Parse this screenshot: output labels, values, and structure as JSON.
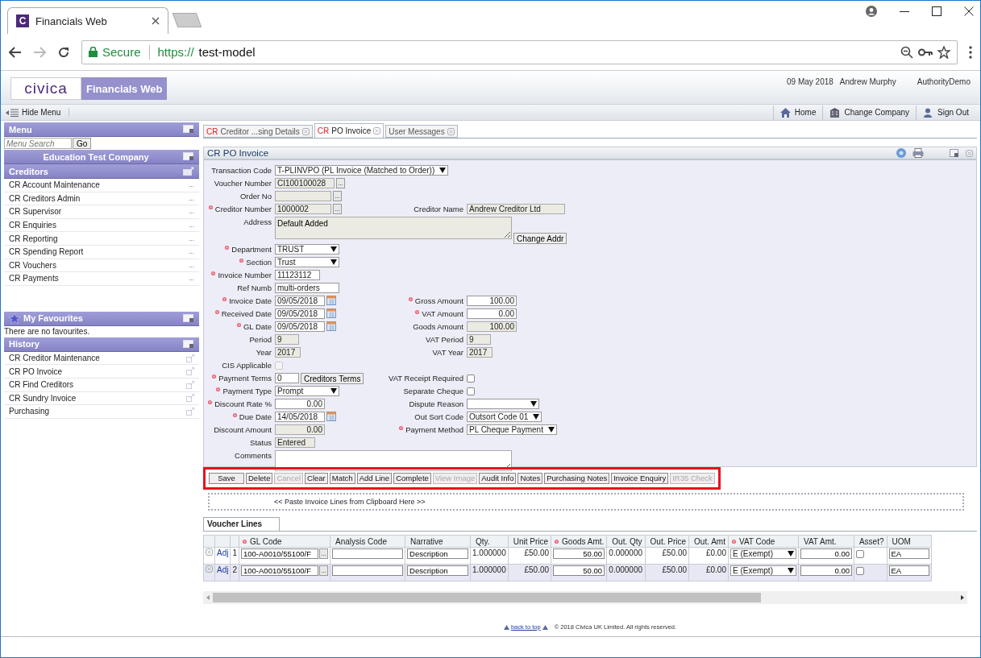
{
  "browser": {
    "favicon_letter": "C",
    "tab_title": "Financials Web",
    "secure_label": "Secure",
    "url_scheme": "https://",
    "url_host": "test-model"
  },
  "header": {
    "logo": "civica",
    "product": "Financials Web",
    "date": "09 May 2018",
    "user": "Andrew Murphy",
    "authority": "AuthorityDemo"
  },
  "toolbar": {
    "hide_menu": "Hide Menu",
    "links": [
      {
        "kind": "home",
        "label": "Home"
      },
      {
        "kind": "company",
        "label": "Change Company"
      },
      {
        "kind": "signout",
        "label": "Sign Out"
      }
    ]
  },
  "sidebar": {
    "menu_title": "Menu",
    "search_placeholder": "Menu Search",
    "go": "Go",
    "company": "Education Test Company",
    "section": "Creditors",
    "items": [
      {
        "label": "CR Account Maintenance",
        "more": "..."
      },
      {
        "label": "CR Creditors Admin",
        "more": "..."
      },
      {
        "label": "CR Supervisor",
        "more": "..."
      },
      {
        "label": "CR Enquiries",
        "more": "..."
      },
      {
        "label": "CR Reporting",
        "more": "..."
      },
      {
        "label": "CR Spending Report",
        "more": "..."
      },
      {
        "label": "CR Vouchers",
        "more": "..."
      },
      {
        "label": "CR Payments",
        "more": "..."
      }
    ],
    "favourites_title": "My Favourites",
    "favourites_empty": "There are no favourites.",
    "history_title": "History",
    "history_items": [
      {
        "label": "CR Creditor Maintenance"
      },
      {
        "label": "CR PO Invoice"
      },
      {
        "label": "CR Find Creditors"
      },
      {
        "label": "CR Sundry Invoice"
      },
      {
        "label": "Purchasing"
      }
    ]
  },
  "tabs": [
    {
      "prefix": "CR",
      "label": "Creditor ...sing Details",
      "selected": false
    },
    {
      "prefix": "CR",
      "label": "PO Invoice",
      "selected": true
    },
    {
      "label": "User Messages",
      "selected": false
    }
  ],
  "form": {
    "title": "CR PO Invoice",
    "rows": [
      {
        "left": {
          "label": "Transaction Code",
          "required": false,
          "kind": "select",
          "value": "T-PLINVPO (PL Invoice (Matched to Order))"
        }
      },
      {
        "left": {
          "label": "Voucher Number",
          "required": false,
          "kind": "text",
          "readonly": true,
          "value": "CI100100028",
          "lookup": "..."
        }
      },
      {
        "left": {
          "label": "Order No",
          "required": false,
          "kind": "text",
          "readonly": true,
          "lookup": "..."
        }
      },
      {
        "left": {
          "label": "Creditor Number",
          "required": true,
          "kind": "text",
          "readonly": true,
          "value": "1000002",
          "lookup": "..."
        },
        "right": {
          "label": "Creditor Name",
          "required": false,
          "kind": "text",
          "readonly": true,
          "value": "Andrew Creditor Ltd"
        }
      },
      {
        "left": {
          "label": "Address",
          "required": false,
          "kind": "textarea",
          "readonly": true,
          "value": "Default Added",
          "button": "Change Addr"
        }
      },
      {
        "left": {
          "label": "Department",
          "required": true,
          "kind": "select",
          "value": "TRUST"
        }
      },
      {
        "left": {
          "label": "Section",
          "required": true,
          "kind": "select",
          "value": "Trust"
        }
      },
      {
        "left": {
          "label": "Invoice Number",
          "required": true,
          "kind": "text",
          "readonly": false,
          "value": "11123112"
        }
      },
      {
        "left": {
          "label": "Ref Numb",
          "required": false,
          "kind": "text",
          "readonly": false,
          "value": "multi-orders"
        }
      },
      {
        "left": {
          "label": "Invoice Date",
          "required": true,
          "kind": "date",
          "value": "09/05/2018"
        },
        "right": {
          "label": "Gross Amount",
          "required": true,
          "kind": "amount",
          "readonly": false,
          "value": "100.00"
        }
      },
      {
        "left": {
          "label": "Received Date",
          "required": true,
          "kind": "date",
          "value": "09/05/2018"
        },
        "right": {
          "label": "VAT Amount",
          "required": true,
          "kind": "amount",
          "readonly": false,
          "value": "0.00"
        }
      },
      {
        "left": {
          "label": "GL Date",
          "required": true,
          "kind": "date",
          "value": "09/05/2018"
        },
        "right": {
          "label": "Goods Amount",
          "required": false,
          "kind": "amount",
          "readonly": true,
          "value": "100.00"
        }
      },
      {
        "left": {
          "label": "Period",
          "required": false,
          "kind": "text",
          "readonly": true,
          "value": "9"
        },
        "right": {
          "label": "VAT Period",
          "required": false,
          "kind": "text",
          "readonly": true,
          "value": "9"
        }
      },
      {
        "left": {
          "label": "Year",
          "required": false,
          "kind": "text",
          "readonly": true,
          "value": "2017"
        },
        "right": {
          "label": "VAT Year",
          "required": false,
          "kind": "text",
          "readonly": true,
          "value": "2017"
        }
      },
      {
        "left": {
          "label": "CIS Applicable",
          "required": false,
          "kind": "checkbox",
          "checked": false,
          "disabled": true
        }
      },
      {
        "left": {
          "label": "Payment Terms",
          "required": true,
          "kind": "text",
          "readonly": false,
          "value": "0",
          "button": "Creditors Terms"
        },
        "right": {
          "label": "VAT Receipt Required",
          "required": false,
          "kind": "checkbox",
          "checked": false,
          "disabled": false
        }
      },
      {
        "left": {
          "label": "Payment Type",
          "required": true,
          "kind": "select",
          "value": "Prompt"
        },
        "right": {
          "label": "Separate Cheque",
          "required": false,
          "kind": "checkbox",
          "checked": false,
          "disabled": false
        }
      },
      {
        "left": {
          "label": "Discount Rate %",
          "required": true,
          "kind": "amount",
          "readonly": false,
          "value": "0.00"
        },
        "right": {
          "label": "Dispute Reason",
          "required": false,
          "kind": "select"
        }
      },
      {
        "left": {
          "label": "Due Date",
          "required": true,
          "kind": "date",
          "value": "14/05/2018"
        },
        "right": {
          "label": "Out Sort Code",
          "required": false,
          "kind": "select",
          "value": "Outsort Code 01"
        }
      },
      {
        "left": {
          "label": "Discount Amount",
          "required": false,
          "kind": "amount",
          "readonly": true,
          "value": "0.00"
        },
        "right": {
          "label": "Payment Method",
          "required": true,
          "kind": "select",
          "value": "PL Cheque Payment"
        }
      },
      {
        "left": {
          "label": "Status",
          "required": false,
          "kind": "text",
          "readonly": true,
          "value": "Entered"
        }
      },
      {
        "left": {
          "label": "Comments",
          "required": false,
          "kind": "textarea",
          "readonly": false
        }
      }
    ],
    "buttons": [
      {
        "label": "Save",
        "disabled": false
      },
      {
        "label": "Delete",
        "disabled": false
      },
      {
        "label": "Cancel",
        "disabled": true
      },
      {
        "label": "Clear",
        "disabled": false
      },
      {
        "label": "Match",
        "disabled": false
      },
      {
        "label": "Add Line",
        "disabled": false
      },
      {
        "label": "Complete",
        "disabled": false
      },
      {
        "label": "View Image",
        "disabled": true
      },
      {
        "label": "Audit Info",
        "disabled": false
      },
      {
        "label": "Notes",
        "disabled": false
      },
      {
        "label": "Purchasing Notes",
        "disabled": false
      },
      {
        "label": "Invoice Enquiry",
        "disabled": false
      },
      {
        "label": "IR35 Check",
        "disabled": true
      }
    ],
    "paste_area": "<< Paste Invoice Lines from Clipboard Here >>"
  },
  "voucher_lines": {
    "tab": "Voucher Lines",
    "columns": [
      {
        "label": "GL Code",
        "required": true
      },
      {
        "label": "Analysis Code",
        "required": false
      },
      {
        "label": "Narrative",
        "required": false
      },
      {
        "label": "Qty.",
        "required": false
      },
      {
        "label": "Unit Price",
        "required": false
      },
      {
        "label": "Goods Amt.",
        "required": true
      },
      {
        "label": "Out. Qty",
        "required": false
      },
      {
        "label": "Out. Price",
        "required": false
      },
      {
        "label": "Out. Amt",
        "required": false
      },
      {
        "label": "VAT Code",
        "required": true
      },
      {
        "label": "VAT Amt.",
        "required": false
      },
      {
        "label": "Asset?",
        "required": false
      },
      {
        "label": "UOM",
        "required": false
      }
    ],
    "rows": [
      {
        "action": "Adj",
        "number": "1",
        "gl_code": "100-A0010/55100/F",
        "lookup": "...",
        "narrative": "Description",
        "qty": "1.000000",
        "unit_price": "£50.00",
        "goods_amt": "50.00",
        "out_qty": "0.000000",
        "out_price": "£50.00",
        "out_amt": "£0.00",
        "vat_code": "E (Exempt)",
        "vat_amt": "0.00",
        "asset": false,
        "uom": "EA"
      },
      {
        "action": "Adj",
        "number": "2",
        "gl_code": "100-A0010/55100/F",
        "lookup": "...",
        "narrative": "Description",
        "qty": "1.000000",
        "unit_price": "£50.00",
        "goods_amt": "50.00",
        "out_qty": "0.000000",
        "out_price": "£50.00",
        "out_amt": "£0.00",
        "vat_code": "E (Exempt)",
        "vat_amt": "0.00",
        "asset": false,
        "uom": "EA"
      }
    ]
  },
  "footer": {
    "back_to_top": "back to top",
    "copyright": "© 2018 Civica UK Limited. All rights reserved."
  }
}
